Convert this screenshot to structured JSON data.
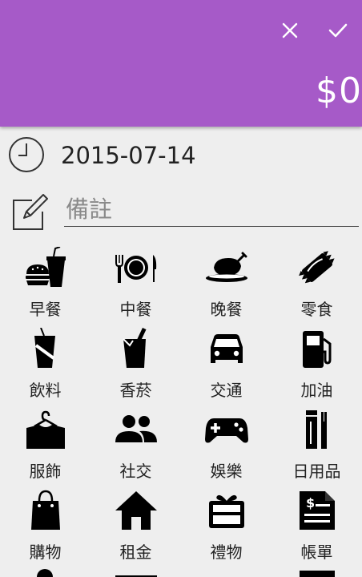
{
  "toolbar": {
    "close_icon": "close-icon",
    "confirm_icon": "check-icon",
    "amount": "$0"
  },
  "date": {
    "value": "2015-07-14",
    "icon": "clock-icon"
  },
  "note": {
    "placeholder": "備註",
    "value": "",
    "icon": "edit-icon"
  },
  "categories": [
    {
      "label": "早餐",
      "icon": "breakfast-icon"
    },
    {
      "label": "中餐",
      "icon": "lunch-icon"
    },
    {
      "label": "晚餐",
      "icon": "dinner-icon"
    },
    {
      "label": "零食",
      "icon": "snack-icon"
    },
    {
      "label": "飲料",
      "icon": "drink-icon"
    },
    {
      "label": "香菸",
      "icon": "cigarette-icon"
    },
    {
      "label": "交通",
      "icon": "car-icon"
    },
    {
      "label": "加油",
      "icon": "gas-icon"
    },
    {
      "label": "服飾",
      "icon": "clothing-icon"
    },
    {
      "label": "社交",
      "icon": "social-icon"
    },
    {
      "label": "娛樂",
      "icon": "gamepad-icon"
    },
    {
      "label": "日用品",
      "icon": "toiletries-icon"
    },
    {
      "label": "購物",
      "icon": "shopping-bag-icon"
    },
    {
      "label": "租金",
      "icon": "house-icon"
    },
    {
      "label": "禮物",
      "icon": "gift-icon"
    },
    {
      "label": "帳單",
      "icon": "bill-icon"
    }
  ],
  "colors": {
    "header": "#a65ac8",
    "background": "#eeeeee",
    "icon": "#000000",
    "text": "#222222"
  }
}
